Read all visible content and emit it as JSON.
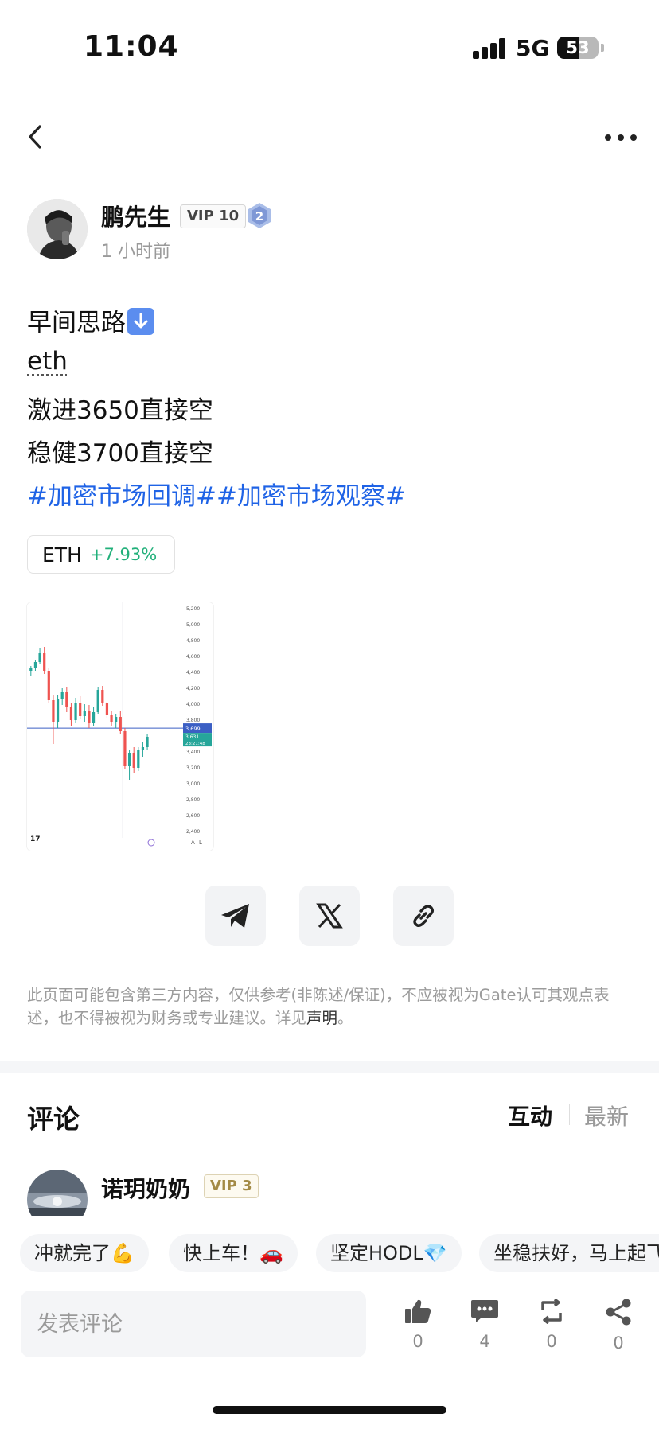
{
  "status_bar": {
    "time": "11:04",
    "network": "5G",
    "battery_level": "53",
    "battery_fraction": 0.53
  },
  "author": {
    "name": "鹏先生",
    "vip": "VIP 10",
    "level": "2",
    "time_ago": "1 小时前"
  },
  "post": {
    "lines": [
      "早间思路",
      "eth",
      "激进3650直接空",
      "稳健3700直接空"
    ],
    "hashtags": "#加密市场回调##加密市场观察#",
    "down_emoji": "down-arrow-emoji"
  },
  "coin": {
    "symbol": "ETH",
    "change": "+7.93%",
    "change_color": "#21b07a"
  },
  "chart_data": {
    "type": "candlestick",
    "yticks": [
      "5,200",
      "5,000",
      "4,800",
      "4,600",
      "4,400",
      "4,200",
      "4,000",
      "3,800",
      "3,600",
      "3,400",
      "3,200",
      "3,000",
      "2,800",
      "2,600",
      "2,400"
    ],
    "ylim": [
      2400,
      5200
    ],
    "current_price_tag": "3,699",
    "price_tag_2": "3,631",
    "countdown": "23:21:48",
    "bottom_right_labels": [
      "A",
      "L"
    ],
    "horizontal_line_value": 3699,
    "candles": [
      {
        "o": 4420,
        "h": 4480,
        "l": 4360,
        "c": 4460
      },
      {
        "o": 4460,
        "h": 4560,
        "l": 4420,
        "c": 4530
      },
      {
        "o": 4530,
        "h": 4700,
        "l": 4500,
        "c": 4640
      },
      {
        "o": 4640,
        "h": 4720,
        "l": 4380,
        "c": 4420
      },
      {
        "o": 4420,
        "h": 4450,
        "l": 4010,
        "c": 4050
      },
      {
        "o": 4050,
        "h": 4120,
        "l": 3500,
        "c": 3780
      },
      {
        "o": 3780,
        "h": 4110,
        "l": 3700,
        "c": 4060
      },
      {
        "o": 4060,
        "h": 4200,
        "l": 3990,
        "c": 4150
      },
      {
        "o": 4150,
        "h": 4220,
        "l": 3900,
        "c": 3960
      },
      {
        "o": 3960,
        "h": 4020,
        "l": 3720,
        "c": 3800
      },
      {
        "o": 3800,
        "h": 4080,
        "l": 3760,
        "c": 4020
      },
      {
        "o": 4020,
        "h": 4100,
        "l": 3810,
        "c": 3850
      },
      {
        "o": 3850,
        "h": 4000,
        "l": 3780,
        "c": 3920
      },
      {
        "o": 3920,
        "h": 3990,
        "l": 3700,
        "c": 3760
      },
      {
        "o": 3760,
        "h": 3960,
        "l": 3720,
        "c": 3900
      },
      {
        "o": 3900,
        "h": 4210,
        "l": 3880,
        "c": 4180
      },
      {
        "o": 4180,
        "h": 4230,
        "l": 3980,
        "c": 4010
      },
      {
        "o": 4010,
        "h": 4030,
        "l": 3820,
        "c": 3860
      },
      {
        "o": 3860,
        "h": 3920,
        "l": 3720,
        "c": 3780
      },
      {
        "o": 3780,
        "h": 3880,
        "l": 3700,
        "c": 3840
      },
      {
        "o": 3840,
        "h": 3920,
        "l": 3620,
        "c": 3660
      },
      {
        "o": 3660,
        "h": 3700,
        "l": 3180,
        "c": 3220
      },
      {
        "o": 3220,
        "h": 3420,
        "l": 3050,
        "c": 3380
      },
      {
        "o": 3380,
        "h": 3460,
        "l": 3140,
        "c": 3200
      },
      {
        "o": 3200,
        "h": 3460,
        "l": 3160,
        "c": 3420
      },
      {
        "o": 3420,
        "h": 3520,
        "l": 3330,
        "c": 3460
      },
      {
        "o": 3460,
        "h": 3620,
        "l": 3420,
        "c": 3590
      }
    ],
    "up_color": "#26a69a",
    "down_color": "#ef5350"
  },
  "share": {
    "telegram": "telegram-icon",
    "x": "x-icon",
    "link": "link-icon"
  },
  "disclaimer": {
    "text": "此页面可能包含第三方内容，仅供参考(非陈述/保证)，不应被视为Gate认可其观点表述，也不得被视为财务或专业建议。详见",
    "link": "声明",
    "end": "。"
  },
  "comments": {
    "title": "评论",
    "tab_active": "互动",
    "tab_latest": "最新",
    "first": {
      "name": "诺玥奶奶",
      "vip": "VIP 3"
    }
  },
  "quick_replies": [
    "冲就完了💪",
    "快上车！🚗",
    "坚定HODL💎",
    "坐稳扶好，马上起飞"
  ],
  "comment_input": {
    "placeholder": "发表评论"
  },
  "actions": {
    "like": "0",
    "comment": "4",
    "repost": "0",
    "share": "0"
  }
}
